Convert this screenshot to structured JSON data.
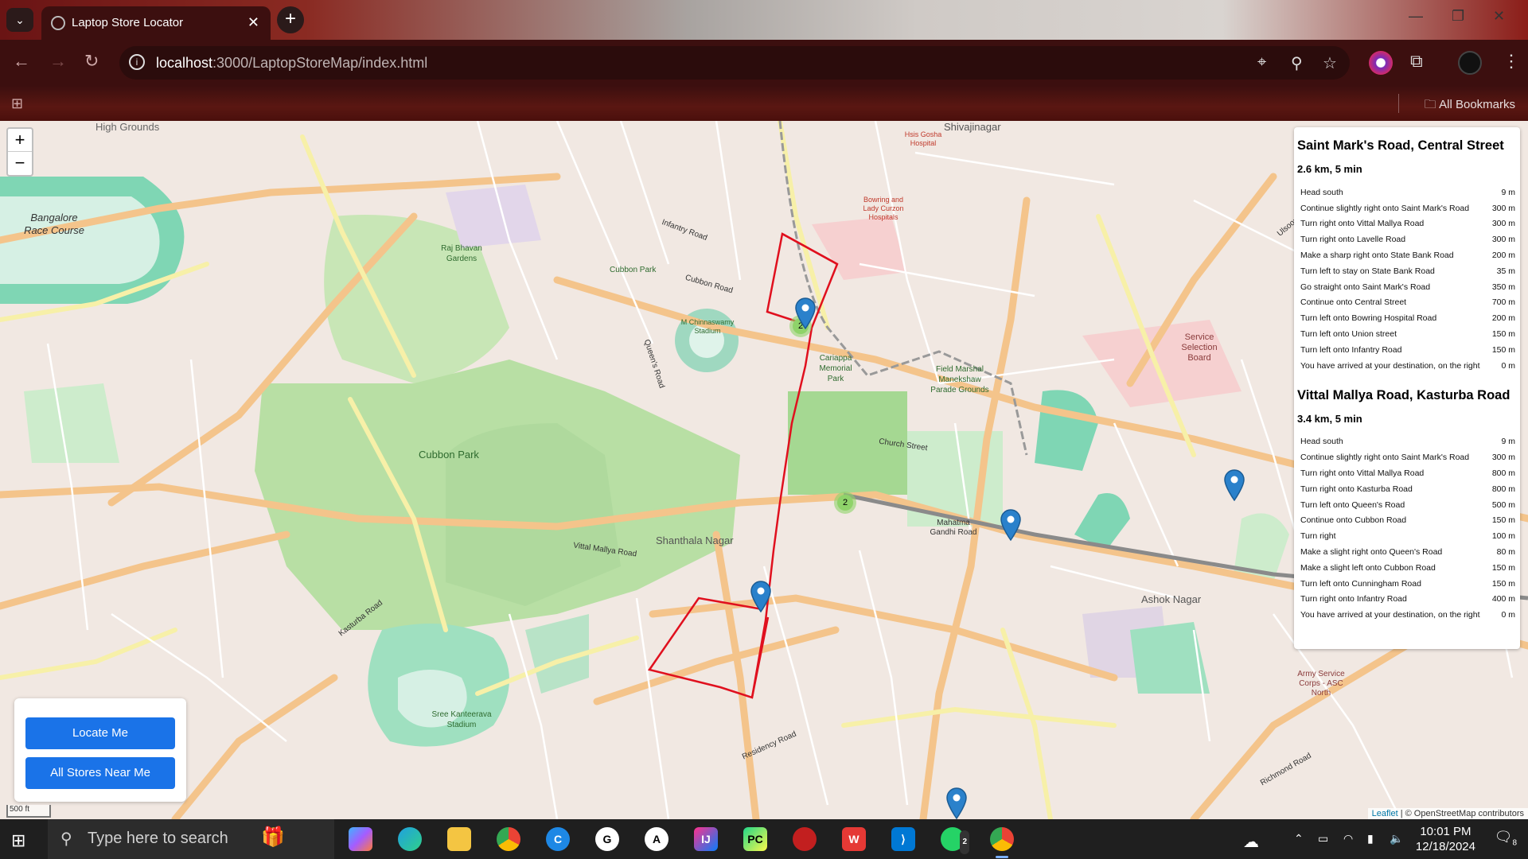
{
  "browser": {
    "tab_title": "Laptop Store Locator",
    "url_host": "localhost",
    "url_path": ":3000/LaptopStoreMap/index.html",
    "bookmarks_label": "All Bookmarks"
  },
  "map": {
    "zoom_in": "+",
    "zoom_out": "−",
    "scale_label": "500 ft",
    "attribution_leaflet": "Leaflet",
    "attribution_rest": " | © OpenStreetMap contributors",
    "cluster_counts": [
      "2",
      "2"
    ],
    "labels": {
      "shivajinagar": "Shivajinagar",
      "race_course": "Bangalore Race Course",
      "cubbon_park": "Cubbon Park",
      "cubbon_park2": "Cubbon Park",
      "shanthala": "Shanthala Nagar",
      "ashok": "Ashok Nagar",
      "service_board": "Service Selection Board",
      "fmm": "Field Marshal Manekshaw Parade Grounds",
      "cariappa": "Cariappa Memorial Park",
      "kanteerava": "Sree Kanteerava Stadium",
      "chinnaswamy": "M Chinnaswamy Stadium",
      "raj_bhavan": "Raj Bhavan Gardens",
      "cubbon_road": "Cubbon Road",
      "mg_road": "Mahatma Gandhi Road",
      "church_street": "Church Street",
      "residency": "Residency Road",
      "richmond": "Richmond Road",
      "kasturba": "Kasturba Road",
      "vittal": "Vittal Mallya Road",
      "queens": "Queen's Road",
      "infantry": "Infantry Road",
      "high_grounds": "High Grounds",
      "army_service": "Army Service Corps - ASC North",
      "bowring": "Bowring and Lady Curzon Hospitals",
      "hsis": "Hsis Gosha Hospital",
      "ulsoor": "Ulsoor Road"
    }
  },
  "route_panel": {
    "routes": [
      {
        "title": "Saint Mark's Road, Central Street",
        "summary": "2.6 km, 5 min",
        "steps": [
          [
            "Head south",
            "9 m"
          ],
          [
            "Continue slightly right onto Saint Mark's Road",
            "300 m"
          ],
          [
            "Turn right onto Vittal Mallya Road",
            "300 m"
          ],
          [
            "Turn right onto Lavelle Road",
            "300 m"
          ],
          [
            "Make a sharp right onto State Bank Road",
            "200 m"
          ],
          [
            "Turn left to stay on State Bank Road",
            "35 m"
          ],
          [
            "Go straight onto Saint Mark's Road",
            "350 m"
          ],
          [
            "Continue onto Central Street",
            "700 m"
          ],
          [
            "Turn left onto Bowring Hospital Road",
            "200 m"
          ],
          [
            "Turn left onto Union street",
            "150 m"
          ],
          [
            "Turn left onto Infantry Road",
            "150 m"
          ],
          [
            "You have arrived at your destination, on the right",
            "0 m"
          ]
        ]
      },
      {
        "title": "Vittal Mallya Road, Kasturba Road",
        "summary": "3.4 km, 5 min",
        "steps": [
          [
            "Head south",
            "9 m"
          ],
          [
            "Continue slightly right onto Saint Mark's Road",
            "300 m"
          ],
          [
            "Turn right onto Vittal Mallya Road",
            "800 m"
          ],
          [
            "Turn right onto Kasturba Road",
            "800 m"
          ],
          [
            "Turn left onto Queen's Road",
            "500 m"
          ],
          [
            "Continue onto Cubbon Road",
            "150 m"
          ],
          [
            "Turn right",
            "100 m"
          ],
          [
            "Make a slight right onto Queen's Road",
            "80 m"
          ],
          [
            "Make a slight left onto Cubbon Road",
            "150 m"
          ],
          [
            "Turn left onto Cunningham Road",
            "150 m"
          ],
          [
            "Turn right onto Infantry Road",
            "400 m"
          ],
          [
            "You have arrived at your destination, on the right",
            "0 m"
          ]
        ]
      }
    ]
  },
  "controls": {
    "locate_me": "Locate Me",
    "all_stores": "All Stores Near Me"
  },
  "taskbar": {
    "search_placeholder": "Type here to search",
    "time": "10:01 PM",
    "date": "12/18/2024",
    "whatsapp_badge": "2",
    "notification_count": "8"
  },
  "colors": {
    "route": "#e0101e",
    "marker": "#2a81cb",
    "cluster": "#8fd36a",
    "button": "#1a73e8",
    "chrome_dark": "#3c0f0f"
  }
}
